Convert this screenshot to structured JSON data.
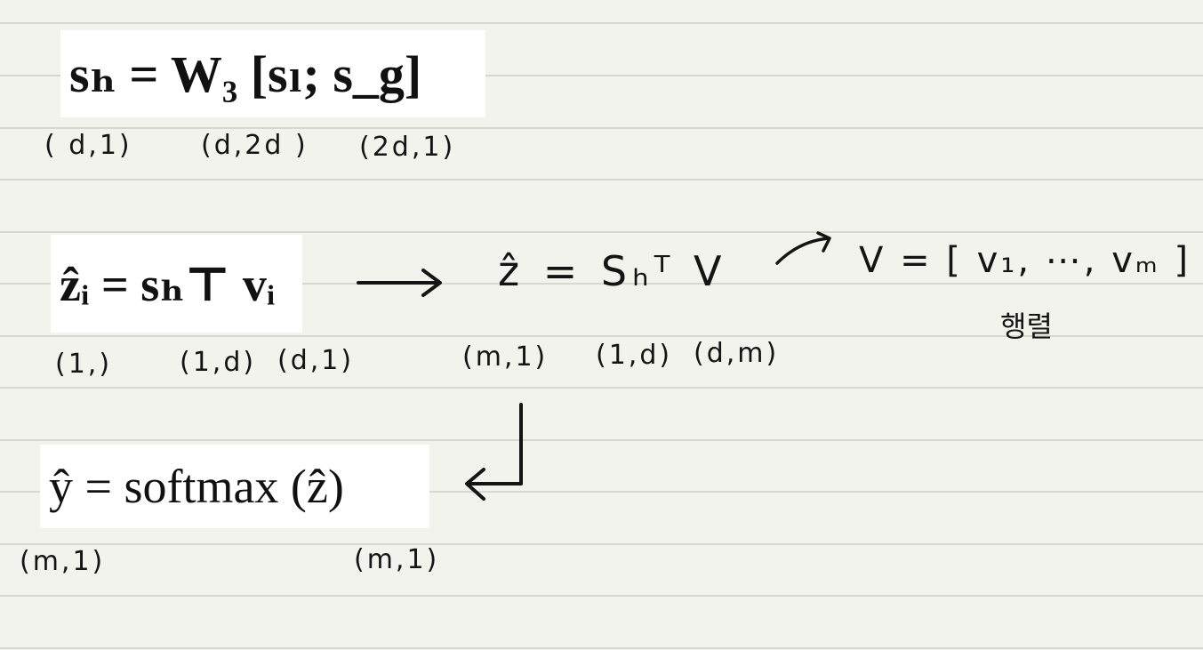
{
  "equations": {
    "eq1": "sₕ = W₃ [sₗ; s_g]",
    "eq2": "ẑᵢ = sₕ⊤ vᵢ",
    "eq3": "ŷ = softmax (ẑ)"
  },
  "handwritten": {
    "eq1_dims": [
      "( d,1)",
      "(d,2d )",
      "(2d,1)"
    ],
    "eq2_dims": [
      "(1,)",
      "(1,d)",
      "(d,1)"
    ],
    "hand_eq": "ẑ = Sₕᵀ V",
    "hand_eq_dims": [
      "(m,1)",
      "(1,d)",
      "(d,m)"
    ],
    "v_def": "V = [ v₁, ⋯, vₘ ]",
    "v_note": "행렬",
    "eq3_dims": [
      "(m,1)",
      "(m,1)"
    ]
  },
  "colors": {
    "paper": "#f3f3ee",
    "rule": "#d7d7cf",
    "ink": "#141414",
    "box": "#ffffff"
  }
}
